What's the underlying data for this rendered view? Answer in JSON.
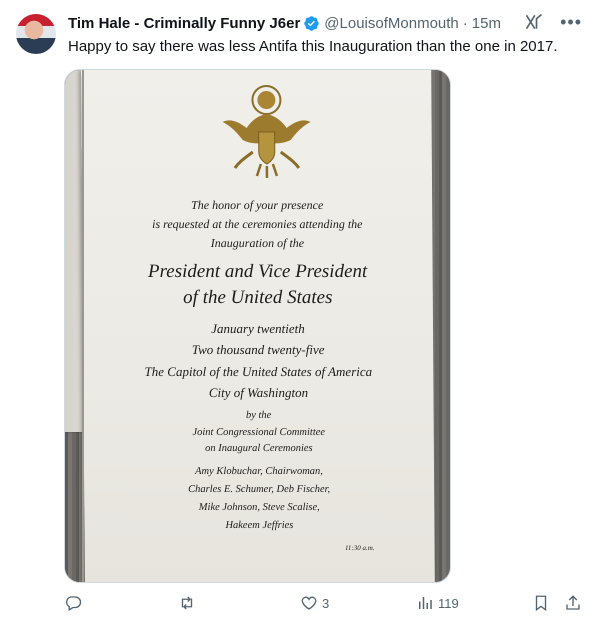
{
  "tweet": {
    "author_name": "Tim Hale - Criminally Funny J6er",
    "handle": "@LouisofMonmouth",
    "separator": "·",
    "time": "15m",
    "text": "Happy to say there was less Antifa this Inauguration than the one in 2017."
  },
  "invitation": {
    "line1": "The honor of your presence",
    "line2": "is requested at the ceremonies attending the",
    "line3": "Inauguration of the",
    "title1": "President and Vice President",
    "title2": "of the United States",
    "date1": "January twentieth",
    "date2": "Two thousand twenty-five",
    "place1": "The Capitol of the United States of America",
    "place2": "City of Washington",
    "by": "by the",
    "committee1": "Joint Congressional Committee",
    "committee2": "on Inaugural Ceremonies",
    "member1": "Amy Klobuchar, Chairwoman,",
    "member2": "Charles E. Schumer, Deb Fischer,",
    "member3": "Mike Johnson, Steve Scalise,",
    "member4": "Hakeem Jeffries",
    "time": "11:30 a.m."
  },
  "actions": {
    "reply_count": "",
    "retweet_count": "",
    "like_count": "3",
    "views_count": "119"
  },
  "icons": [
    "verified-badge-icon",
    "grok-icon",
    "more-icon",
    "reply-icon",
    "retweet-icon",
    "like-icon",
    "views-icon",
    "bookmark-icon",
    "share-icon"
  ],
  "colors": {
    "verified": "#1d9bf0",
    "muted": "#536471",
    "text": "#0f1419"
  }
}
